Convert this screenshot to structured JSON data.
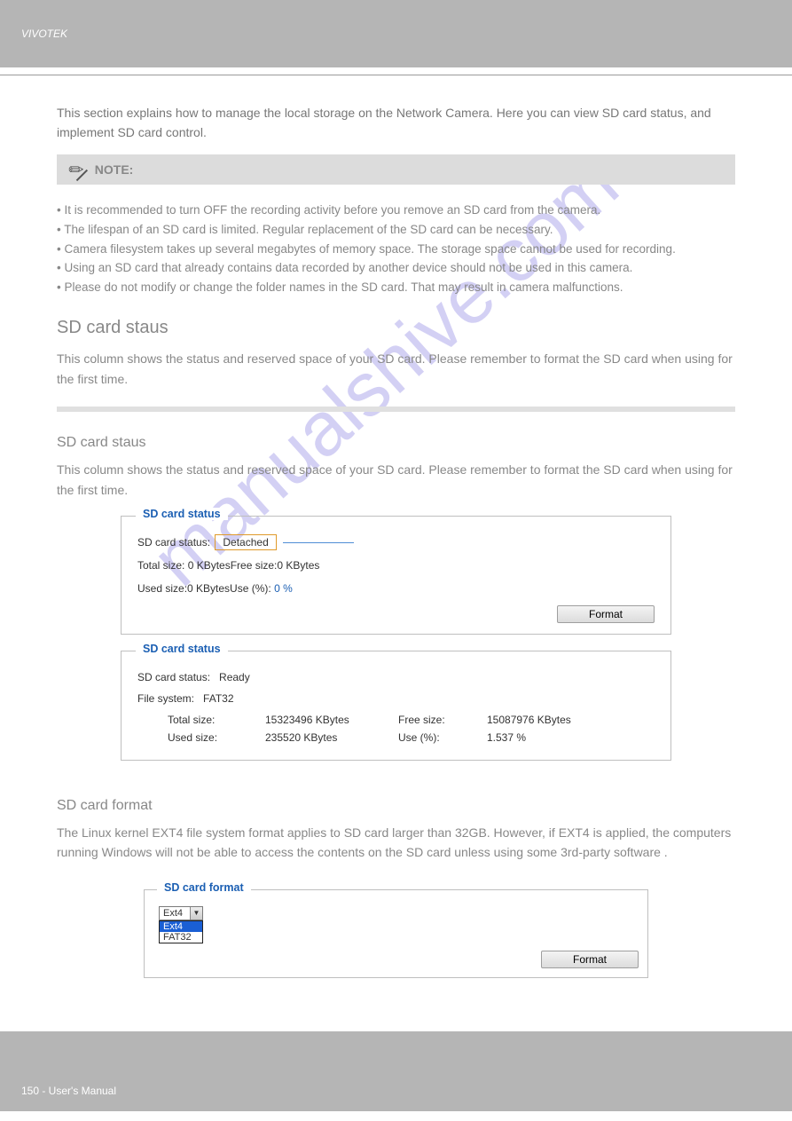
{
  "header": {
    "left": "VIVOTEK",
    "right": ""
  },
  "intro": "This section explains how to manage the local storage on the Network Camera. Here you can view SD card status, and implement SD card control.",
  "note": {
    "label": "NOTE:",
    "lines": [
      "• It is recommended to turn OFF the recording activity before you remove an SD card from the camera.",
      "• The lifespan of an SD card is limited. Regular replacement of the SD card can be necessary.",
      "• Camera filesystem takes up several megabytes of memory space. The storage space cannot be used for recording.",
      "• Using an SD card that already contains data recorded by another device should not be used in this camera.",
      "• Please do not modify or change the folder names in the SD card. That may result in camera malfunctions."
    ]
  },
  "section": {
    "title": "SD card staus",
    "desc": "This column shows the status and reserved space of your SD card. Please remember to format the SD card when using for the first time."
  },
  "panel1": {
    "legend": "SD card status",
    "status_label": "SD card status:",
    "status_value": "Detached",
    "line2": "Total size: 0  KBytesFree size:0  KBytes",
    "used_label": "Used size:0  KBytesUse (%): ",
    "used_value": "0 %",
    "format_btn": "Format"
  },
  "panel2": {
    "legend": "SD card status",
    "status_label": "SD card status:",
    "status_value": "Ready",
    "fs_label": "File system:",
    "fs_value": "FAT32",
    "stats": {
      "total_label": "Total size:",
      "total_value": "15323496  KBytes",
      "free_label": "Free size:",
      "free_value": "15087976  KBytes",
      "used_label": "Used size:",
      "used_value": "235520  KBytes",
      "pct_label": "Use (%):",
      "pct_value": "1.537 %"
    }
  },
  "subheading": "SD card format",
  "sub_desc": "The Linux kernel EXT4 file system format applies to SD card larger than 32GB. However, if EXT4 is applied, the computers running Windows will not be able to access the contents on the SD card unless using some 3rd-party software .",
  "panel3": {
    "legend": "SD card format",
    "selected": "Ext4",
    "opt1": "Ext4",
    "opt2": "FAT32",
    "format_btn": "Format"
  },
  "footer": {
    "left": "150 - User's Manual",
    "right": ""
  },
  "watermark": "manualshive.com"
}
